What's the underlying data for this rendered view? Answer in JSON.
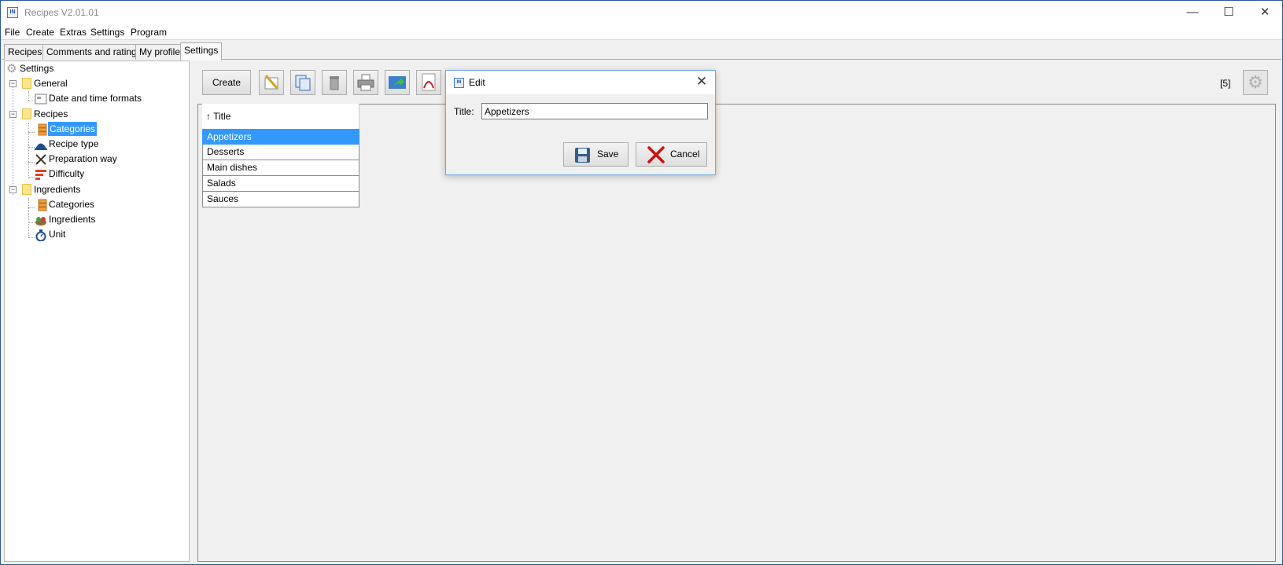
{
  "window": {
    "title": "Recipes V2.01.01",
    "app_icon_text": "IN",
    "minimize_glyph": "—",
    "maximize_glyph": "☐",
    "close_glyph": "✕"
  },
  "menu": [
    "File",
    "Create",
    "Extras",
    "Settings",
    "Program"
  ],
  "tabs": [
    "Recipes",
    "Comments and ratings",
    "My profile",
    "Settings"
  ],
  "tree": {
    "root": "Settings",
    "general": "General",
    "date_time": "Date and time formats",
    "recipes": "Recipes",
    "categories": "Categories",
    "recipe_type": "Recipe type",
    "preparation_way": "Preparation way",
    "difficulty": "Difficulty",
    "ingredients": "Ingredients",
    "ing_categories": "Categories",
    "ing_ingredients": "Ingredients",
    "unit": "Unit"
  },
  "toolbar": {
    "create_label": "Create",
    "count": "[5]"
  },
  "grid": {
    "header": "↑ Title",
    "rows": [
      "Appetizers",
      "Desserts",
      "Main dishes",
      "Salads",
      "Sauces"
    ]
  },
  "dialog": {
    "title": "Edit",
    "close_glyph": "✕",
    "title_label": "Title:",
    "title_value": "Appetizers",
    "save_label": "Save",
    "cancel_label": "Cancel"
  },
  "colors": {
    "selection": "#3399ff",
    "folder": "#fde58b",
    "accent_blue": "#2b579a"
  }
}
